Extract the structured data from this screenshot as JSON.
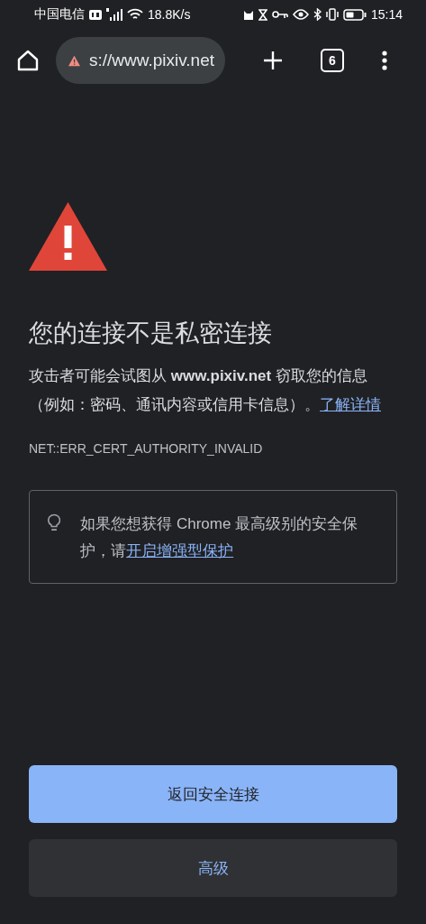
{
  "status_bar": {
    "carrier": "中国电信",
    "network_speed": "18.8K/s",
    "time": "15:14"
  },
  "toolbar": {
    "url": "s://www.pixiv.net",
    "tab_count": "6"
  },
  "error": {
    "title": "您的连接不是私密连接",
    "description": "攻击者可能会试图从 **www.pixiv.net** 窃取您的信息（例如：密码、通讯内容或信用卡信息）。",
    "learn_more": "了解详情",
    "code": "NET::ERR_CERT_AUTHORITY_INVALID"
  },
  "tip": {
    "text": "如果您想获得 Chrome 最高级别的安全保护，请",
    "link": "开启增强型保护"
  },
  "buttons": [
    {
      "label": "返回安全连接",
      "kind": "primary"
    },
    {
      "label": "高级",
      "kind": "secondary"
    }
  ]
}
